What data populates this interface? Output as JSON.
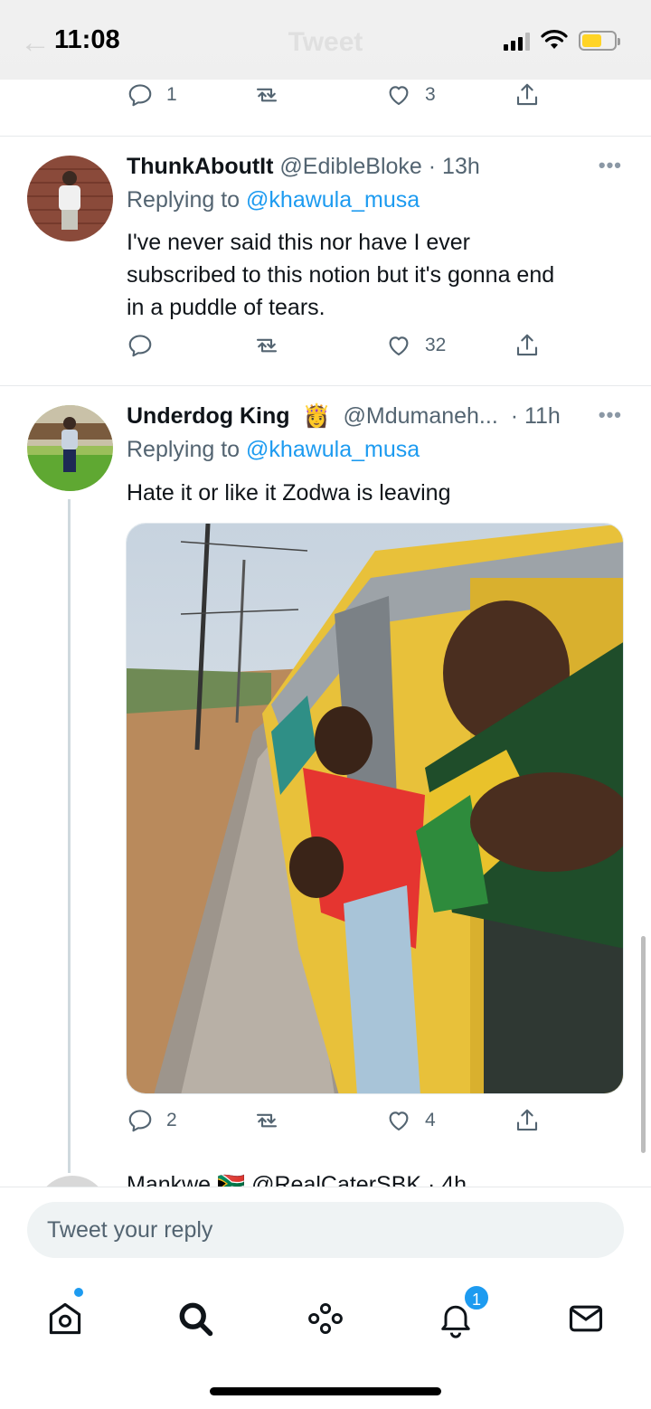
{
  "status_bar": {
    "time": "11:08",
    "header_title": "Tweet"
  },
  "top_tweet_actions": {
    "replies": "1",
    "retweets": "",
    "likes": "3"
  },
  "tweets": [
    {
      "display_name": "ThunkAboutIt",
      "handle": "@EdibleBloke",
      "time": "· 13h",
      "replying_prefix": "Replying to ",
      "replying_to": "@khawula_musa",
      "text_lines": [
        "I've never said this nor have I ever",
        "subscribed to this notion but it's gonna end",
        "in a puddle of tears."
      ],
      "replies": "",
      "retweets": "",
      "likes": "32"
    },
    {
      "display_name": "Underdog King",
      "name_emoji": "👸",
      "handle": "@Mdumaneh...",
      "time": "· 11h",
      "replying_prefix": "Replying to ",
      "replying_to": "@khawula_musa",
      "text": "Hate it or like it Zodwa is leaving",
      "replies": "2",
      "retweets": "",
      "likes": "4"
    }
  ],
  "peek_tweet": {
    "text": "Mankwe 🇿🇦 @RealCaterSBK · 4h"
  },
  "reply_bar": {
    "placeholder": "Tweet your reply"
  },
  "tab_bar": {
    "items": [
      "home-icon",
      "search-icon",
      "spaces-icon",
      "notifications-icon",
      "messages-icon"
    ],
    "notification_badge": "1"
  },
  "colors": {
    "accent": "#1d9bf0",
    "secondary_text": "#536471",
    "divider": "#e6e9eb"
  }
}
